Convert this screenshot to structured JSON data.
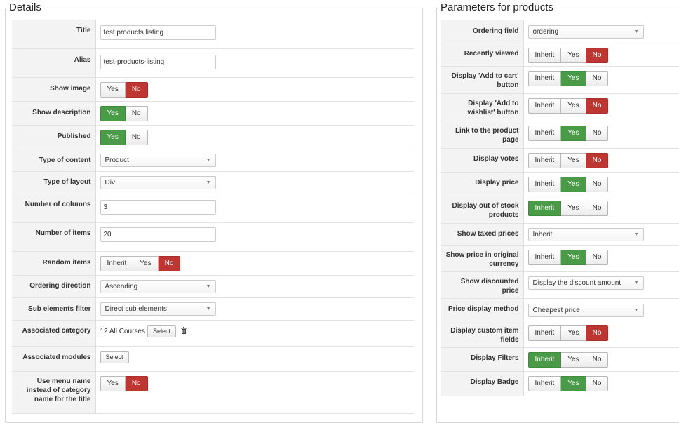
{
  "details": {
    "legend": "Details",
    "title_label": "Title",
    "title_value": "test products listing",
    "alias_label": "Alias",
    "alias_value": "test-products-listing",
    "show_image_label": "Show image",
    "show_description_label": "Show description",
    "published_label": "Published",
    "type_content_label": "Type of content",
    "type_content_value": "Product",
    "type_layout_label": "Type of layout",
    "type_layout_value": "Div",
    "num_columns_label": "Number of columns",
    "num_columns_value": "3",
    "num_items_label": "Number of items",
    "num_items_value": "20",
    "random_items_label": "Random items",
    "ordering_direction_label": "Ordering direction",
    "ordering_direction_value": "Ascending",
    "sub_elements_label": "Sub elements filter",
    "sub_elements_value": "Direct sub elements",
    "assoc_category_label": "Associated category",
    "assoc_category_value": "12 All Courses",
    "assoc_modules_label": "Associated modules",
    "menu_name_label": "Use menu name instead of category name for the title",
    "yes": "Yes",
    "no": "No",
    "inherit": "Inherit",
    "select": "Select"
  },
  "params": {
    "legend": "Parameters for products",
    "ordering_field_label": "Ordering field",
    "ordering_field_value": "ordering",
    "recently_viewed_label": "Recently viewed",
    "add_to_cart_label": "Display 'Add to cart' button",
    "add_to_wishlist_label": "Display 'Add to wishlist' button",
    "link_product_label": "Link to the product page",
    "display_votes_label": "Display votes",
    "display_price_label": "Display price",
    "out_of_stock_label": "Display out of stock products",
    "taxed_prices_label": "Show taxed prices",
    "taxed_prices_value": "Inherit",
    "original_currency_label": "Show price in original currency",
    "discounted_label": "Show discounted price",
    "discounted_value": "Display the discount amount",
    "price_method_label": "Price display method",
    "price_method_value": "Cheapest price",
    "custom_fields_label": "Display custom item fields",
    "filters_label": "Display Filters",
    "badge_label": "Display Badge",
    "inherit": "Inherit",
    "yes": "Yes",
    "no": "No"
  },
  "colors": {
    "active_green": "#4a9b47",
    "active_red": "#bd3631"
  },
  "icons": {
    "trash": "trash-icon",
    "dropdown": "chevron-down-icon"
  }
}
